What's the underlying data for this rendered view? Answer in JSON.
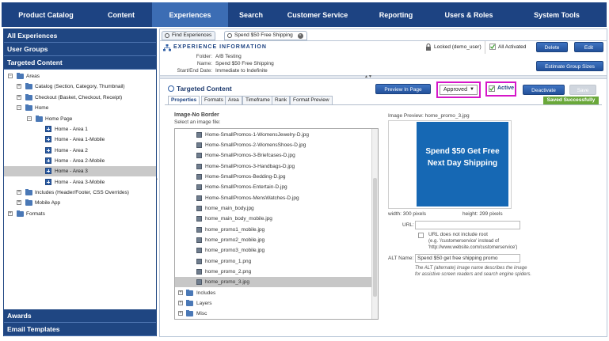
{
  "nav": {
    "items": [
      {
        "label": "Product Catalog"
      },
      {
        "label": "Content"
      },
      {
        "label": "Experiences"
      },
      {
        "label": "Search"
      },
      {
        "label": "Customer Service"
      },
      {
        "label": "Reporting"
      },
      {
        "label": "Users & Roles"
      },
      {
        "label": "System Tools"
      }
    ],
    "active": "Experiences"
  },
  "left": {
    "headers": [
      "All Experiences",
      "User Groups",
      "Targeted Content"
    ],
    "footer_headers": [
      "Awards",
      "Email Templates"
    ],
    "tree": [
      {
        "label": "Areas"
      },
      {
        "label": "Catalog (Section, Category, Thumbnail)"
      },
      {
        "label": "Checkout (Basket, Checkout, Receipt)"
      },
      {
        "label": "Home"
      },
      {
        "label": "Home Page"
      },
      {
        "label": "Home - Area 1"
      },
      {
        "label": "Home - Area 1-Mobile"
      },
      {
        "label": "Home - Area 2"
      },
      {
        "label": "Home - Area 2-Mobile"
      },
      {
        "label": "Home - Area 3"
      },
      {
        "label": "Home - Area 3-Mobile"
      },
      {
        "label": "Includes (Header/Footer, CSS Overrides)"
      },
      {
        "label": "Mobile App"
      },
      {
        "label": "Formats"
      }
    ],
    "selected": "Home - Area 3"
  },
  "tabs": [
    {
      "label": "Find Experiences"
    },
    {
      "label": "Spend $50 Free Shipping"
    }
  ],
  "experience": {
    "title": "EXPERIENCE INFORMATION",
    "folder_label": "Folder:",
    "folder": "A/B Testing",
    "name_label": "Name:",
    "name": "Spend $50 Free Shipping",
    "dates_label": "Start/End Date:",
    "dates": "Immediate to Indefinite",
    "locked": "Locked (demo_user)",
    "activated": "All Activated",
    "delete_label": "Delete",
    "edit_label": "Edit",
    "estimate_label": "Estimate Group Sizes"
  },
  "targeted": {
    "title": "Targeted Content",
    "preview_label": "Preview In Page",
    "status": "Approved",
    "active_label": "Active",
    "deactivate_label": "Deactivate",
    "save_label": "Save",
    "saved_msg": "Saved Successfully",
    "subtabs": [
      "Properties",
      "Formats",
      "Area",
      "Timeframe",
      "Rank",
      "Format Preview"
    ]
  },
  "properties": {
    "section_title": "Image-No Border",
    "select_label": "Select an image file:",
    "files": [
      "Home-SmallPromos-1-WomensJewelry-D.jpg",
      "Home-SmallPromos-2-WomensShoes-D.jpg",
      "Home-SmallPromos-3-Briefcases-D.jpg",
      "Home-SmallPromos-3-Handbags-D.jpg",
      "Home-SmallPromos-Bedding-D.jpg",
      "Home-SmallPromos-Entertain-D.jpg",
      "Home-SmallPromos-MensWatches-D.jpg",
      "home_main_body.jpg",
      "home_main_body_mobile.jpg",
      "home_promo1_mobile.jpg",
      "home_promo2_mobile.jpg",
      "home_promo3_mobile.jpg",
      "home_promo_1.png",
      "home_promo_2.png",
      "home_promo_3.jpg"
    ],
    "selected_file": "home_promo_3.jpg",
    "folders": [
      "Includes",
      "Layers",
      "Misc"
    ],
    "preview_label": "Image Preview: home_promo_3.jpg",
    "promo_text": "Spend $50 Get Free Next Day Shipping",
    "width_text": "width: 300 pixels",
    "height_text": "height: 299 pixels",
    "url_label": "URL:",
    "url_value": "",
    "root_check": "URL does not include root",
    "root_hint1": "(e.g. '/customerservice' instead of",
    "root_hint2": "'http://www.website.com/customerservice')",
    "alt_label": "ALT Name:",
    "alt_value": "Spend $50 get free shipping promo",
    "alt_hint1": "The ALT (alternate) image name describes the image",
    "alt_hint2": "for assistive screen readers and search engine spiders."
  },
  "colors": {
    "nav": "#1d4382",
    "nav_active": "#3c6db4",
    "promo": "#1668b4",
    "highlight": "#d516c8",
    "saved": "#6aa83a"
  }
}
